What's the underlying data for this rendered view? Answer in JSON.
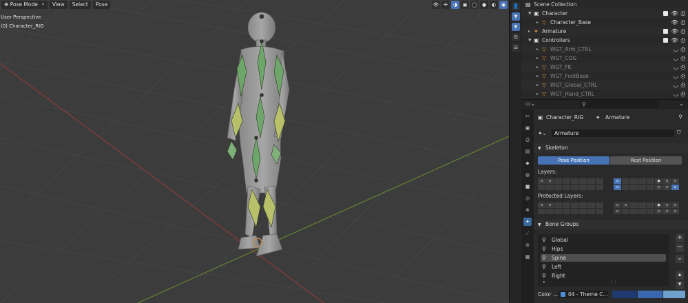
{
  "viewport": {
    "mode_label": "Pose Mode",
    "menus": [
      "View",
      "Select",
      "Pose"
    ],
    "perspective_label": "User Perspective",
    "object_label": "(0) Character_RIG"
  },
  "outliner": {
    "rows": [
      {
        "label": "Scene Collection",
        "indent": 0,
        "icon": "scene-collection-icon",
        "type": "root"
      },
      {
        "label": "Character",
        "indent": 1,
        "icon": "collection-icon",
        "type": "collection"
      },
      {
        "label": "Character_Base",
        "indent": 2,
        "icon": "mesh-object-icon",
        "type": "object"
      },
      {
        "label": "Armature",
        "indent": 1,
        "icon": "armature-object-icon",
        "type": "object"
      },
      {
        "label": "Controllers",
        "indent": 1,
        "icon": "collection-icon",
        "type": "collection"
      },
      {
        "label": "WGT_Arm_CTRL",
        "indent": 2,
        "icon": "mesh-object-icon",
        "type": "dim"
      },
      {
        "label": "WGT_COG",
        "indent": 2,
        "icon": "mesh-object-icon",
        "type": "dim"
      },
      {
        "label": "WGT_FK",
        "indent": 2,
        "icon": "mesh-object-icon",
        "type": "dim"
      },
      {
        "label": "WGT_FootBase",
        "indent": 2,
        "icon": "mesh-object-icon",
        "type": "dim"
      },
      {
        "label": "WGT_Global_CTRL",
        "indent": 2,
        "icon": "mesh-object-icon",
        "type": "dim"
      },
      {
        "label": "WGT_Hand_CTRL",
        "indent": 2,
        "icon": "mesh-object-icon",
        "type": "dim"
      }
    ]
  },
  "properties": {
    "breadcrumb_object": "Character_RIG",
    "breadcrumb_data": "Armature",
    "data_name": "Armature",
    "skeleton_panel": "Skeleton",
    "pose_position": "Pose Position",
    "rest_position": "Rest Position",
    "layers_label": "Layers:",
    "protected_layers_label": "Protected Layers:",
    "bone_groups_panel": "Bone Groups",
    "bone_groups": [
      "Global",
      "Hips",
      "Spine",
      "Left",
      "Right"
    ],
    "selected_group": "Spine",
    "color_label": "Color ...",
    "color_set": "04 - Theme C..."
  },
  "colors": {
    "accent": "#4772b3",
    "x_axis": "#9a3b3b",
    "y_axis": "#6c8f2e"
  }
}
